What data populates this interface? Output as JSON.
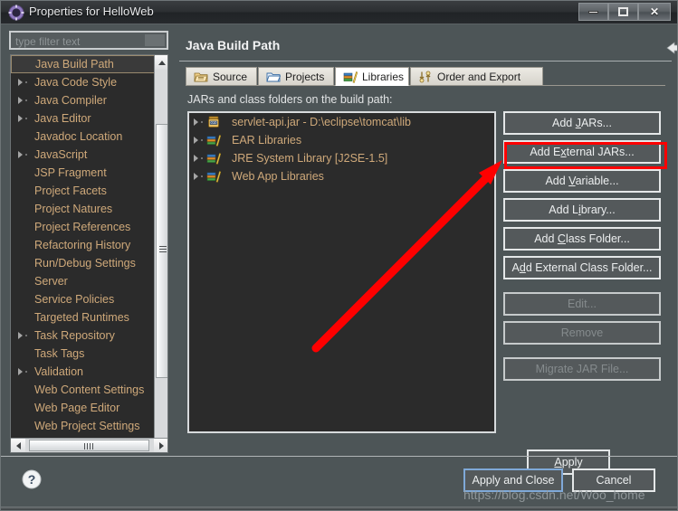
{
  "window": {
    "title": "Properties for HelloWeb",
    "icon": "gear-icon",
    "controls": {
      "minimize": "–",
      "maximize": "□",
      "close": "✕"
    }
  },
  "sidebar": {
    "filter": {
      "placeholder": "type filter text",
      "value": ""
    },
    "items": [
      {
        "label": "Java Build Path",
        "expandable": false,
        "selected": true
      },
      {
        "label": "Java Code Style",
        "expandable": true,
        "selected": false
      },
      {
        "label": "Java Compiler",
        "expandable": true,
        "selected": false
      },
      {
        "label": "Java Editor",
        "expandable": true,
        "selected": false
      },
      {
        "label": "Javadoc Location",
        "expandable": false,
        "selected": false
      },
      {
        "label": "JavaScript",
        "expandable": true,
        "selected": false
      },
      {
        "label": "JSP Fragment",
        "expandable": false,
        "selected": false
      },
      {
        "label": "Project Facets",
        "expandable": false,
        "selected": false
      },
      {
        "label": "Project Natures",
        "expandable": false,
        "selected": false
      },
      {
        "label": "Project References",
        "expandable": false,
        "selected": false
      },
      {
        "label": "Refactoring History",
        "expandable": false,
        "selected": false
      },
      {
        "label": "Run/Debug Settings",
        "expandable": false,
        "selected": false
      },
      {
        "label": "Server",
        "expandable": false,
        "selected": false
      },
      {
        "label": "Service Policies",
        "expandable": false,
        "selected": false
      },
      {
        "label": "Targeted Runtimes",
        "expandable": false,
        "selected": false
      },
      {
        "label": "Task Repository",
        "expandable": true,
        "selected": false
      },
      {
        "label": "Task Tags",
        "expandable": false,
        "selected": false
      },
      {
        "label": "Validation",
        "expandable": true,
        "selected": false
      },
      {
        "label": "Web Content Settings",
        "expandable": false,
        "selected": false
      },
      {
        "label": "Web Page Editor",
        "expandable": false,
        "selected": false
      },
      {
        "label": "Web Project Settings",
        "expandable": false,
        "selected": false
      }
    ]
  },
  "main": {
    "page_title": "Java Build Path",
    "nav": {
      "back_icon": "back-arrow-icon",
      "back_menu_icon": "chevron-down-icon",
      "forward_icon": "forward-arrow-icon",
      "forward_menu_icon": "chevron-down-icon",
      "view_menu_icon": "chevron-down-icon"
    },
    "tabs": [
      {
        "label": "Source",
        "icon": "source-folder-icon",
        "active": false
      },
      {
        "label": "Projects",
        "icon": "projects-folder-icon",
        "active": false
      },
      {
        "label": "Libraries",
        "icon": "libraries-books-icon",
        "active": true
      },
      {
        "label": "Order and Export",
        "icon": "order-export-arrows-icon",
        "active": false
      }
    ],
    "list_label": "JARs and class folders on the build path:",
    "list_items": [
      {
        "label": "servlet-api.jar - D:\\eclipse\\tomcat\\lib",
        "icon": "jar-icon"
      },
      {
        "label": "EAR Libraries",
        "icon": "library-icon"
      },
      {
        "label": "JRE System Library [J2SE-1.5]",
        "icon": "library-icon"
      },
      {
        "label": "Web App Libraries",
        "icon": "library-icon"
      }
    ],
    "buttons": [
      {
        "label": "Add JARs...",
        "mnemonic": "J",
        "enabled": true,
        "highlighted": false
      },
      {
        "label": "Add External JARs...",
        "mnemonic": "x",
        "enabled": true,
        "highlighted": true
      },
      {
        "label": "Add Variable...",
        "mnemonic": "V",
        "enabled": true,
        "highlighted": false
      },
      {
        "label": "Add Library...",
        "mnemonic": "i",
        "enabled": true,
        "highlighted": false
      },
      {
        "label": "Add Class Folder...",
        "mnemonic": "C",
        "enabled": true,
        "highlighted": false
      },
      {
        "label": "Add External Class Folder...",
        "mnemonic": "d",
        "enabled": true,
        "highlighted": false
      },
      {
        "label": "Edit...",
        "mnemonic": "",
        "enabled": false,
        "highlighted": false,
        "gap": true
      },
      {
        "label": "Remove",
        "mnemonic": "",
        "enabled": false,
        "highlighted": false
      },
      {
        "label": "Migrate JAR File...",
        "mnemonic": "",
        "enabled": false,
        "highlighted": false,
        "gap": true
      }
    ],
    "apply_label": "Apply"
  },
  "footer": {
    "help_icon": "help-question-icon",
    "apply_and_close_label": "Apply and Close",
    "cancel_label": "Cancel",
    "watermark": "https://blog.csdn.net/Woo_home"
  },
  "annotation": {
    "highlight_color": "#fe0000",
    "highlight_target": "Add External JARs...",
    "arrow_from": "347,380",
    "arrow_to": "558,175"
  }
}
